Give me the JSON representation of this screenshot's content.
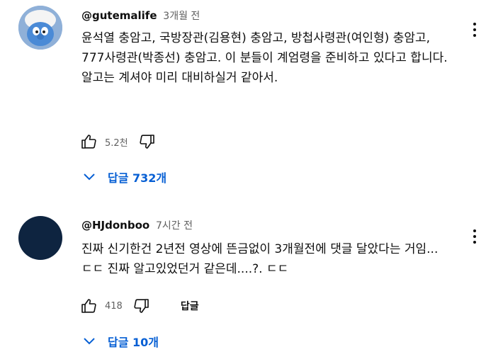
{
  "comments": [
    {
      "author": "@gutemalife",
      "time": "3개월 전",
      "text": "윤석열 충암고, 국방장관(김용현) 충암고, 방첩사령관(여인형) 충암고, 777사령관(박종선) 충암고. 이 분들이 계엄령을 준비하고 있다고 합니다. 알고는 계셔야 미리 대비하실거 같아서.",
      "likes": "5.2천",
      "reply_label": "",
      "replies_label": "답글 732개"
    },
    {
      "author": "@HJdonboo",
      "time": "7시간 전",
      "text": "진짜 신기한건 2년전 영상에 뜬금없이 3개월전에 댓글 달았다는 거임... ㄷㄷ 진짜 알고있었던거 같은데....?. ㄷㄷ",
      "likes": "418",
      "reply_label": "답글",
      "replies_label": "답글 10개"
    }
  ],
  "icons": {
    "like": "thumb-up-icon",
    "dislike": "thumb-down-icon",
    "more": "more-vert-icon",
    "expand": "chevron-down-icon"
  },
  "colors": {
    "link": "#065fd4",
    "secondary": "#606060",
    "text": "#0f0f0f"
  }
}
